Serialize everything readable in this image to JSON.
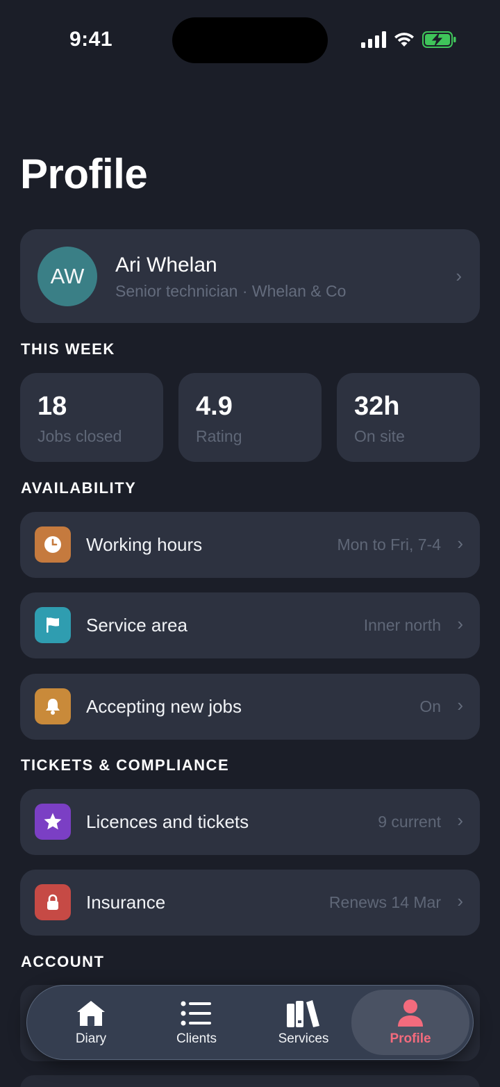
{
  "status": {
    "time": "9:41"
  },
  "page": {
    "title": "Profile"
  },
  "profile": {
    "initials": "AW",
    "name": "Ari Whelan",
    "subtitle": "Senior technician · Whelan & Co"
  },
  "sections": {
    "this_week": "THIS WEEK",
    "availability": "AVAILABILITY",
    "tickets": "TICKETS & COMPLIANCE",
    "account": "ACCOUNT"
  },
  "stats": [
    {
      "value": "18",
      "label": "Jobs closed"
    },
    {
      "value": "4.9",
      "label": "Rating"
    },
    {
      "value": "32h",
      "label": "On site"
    }
  ],
  "availability": [
    {
      "label": "Working hours",
      "value": "Mon to Fri, 7-4",
      "icon": "clock-icon",
      "color": "#c57a3e"
    },
    {
      "label": "Service area",
      "value": "Inner north",
      "icon": "flag-icon",
      "color": "#2f9db0"
    },
    {
      "label": "Accepting new jobs",
      "value": "On",
      "icon": "bell-icon",
      "color": "#c98a3a"
    }
  ],
  "tickets": [
    {
      "label": "Licences and tickets",
      "value": "9 current",
      "icon": "star-icon",
      "color": "#7b3fc4"
    },
    {
      "label": "Insurance",
      "value": "Renews 14 Mar",
      "icon": "lock-icon",
      "color": "#c64a45"
    }
  ],
  "tabs": [
    {
      "label": "Diary",
      "icon": "house-icon"
    },
    {
      "label": "Clients",
      "icon": "list-icon"
    },
    {
      "label": "Services",
      "icon": "books-icon"
    },
    {
      "label": "Profile",
      "icon": "person-icon",
      "active": true
    }
  ],
  "accent": "#f36b7d"
}
